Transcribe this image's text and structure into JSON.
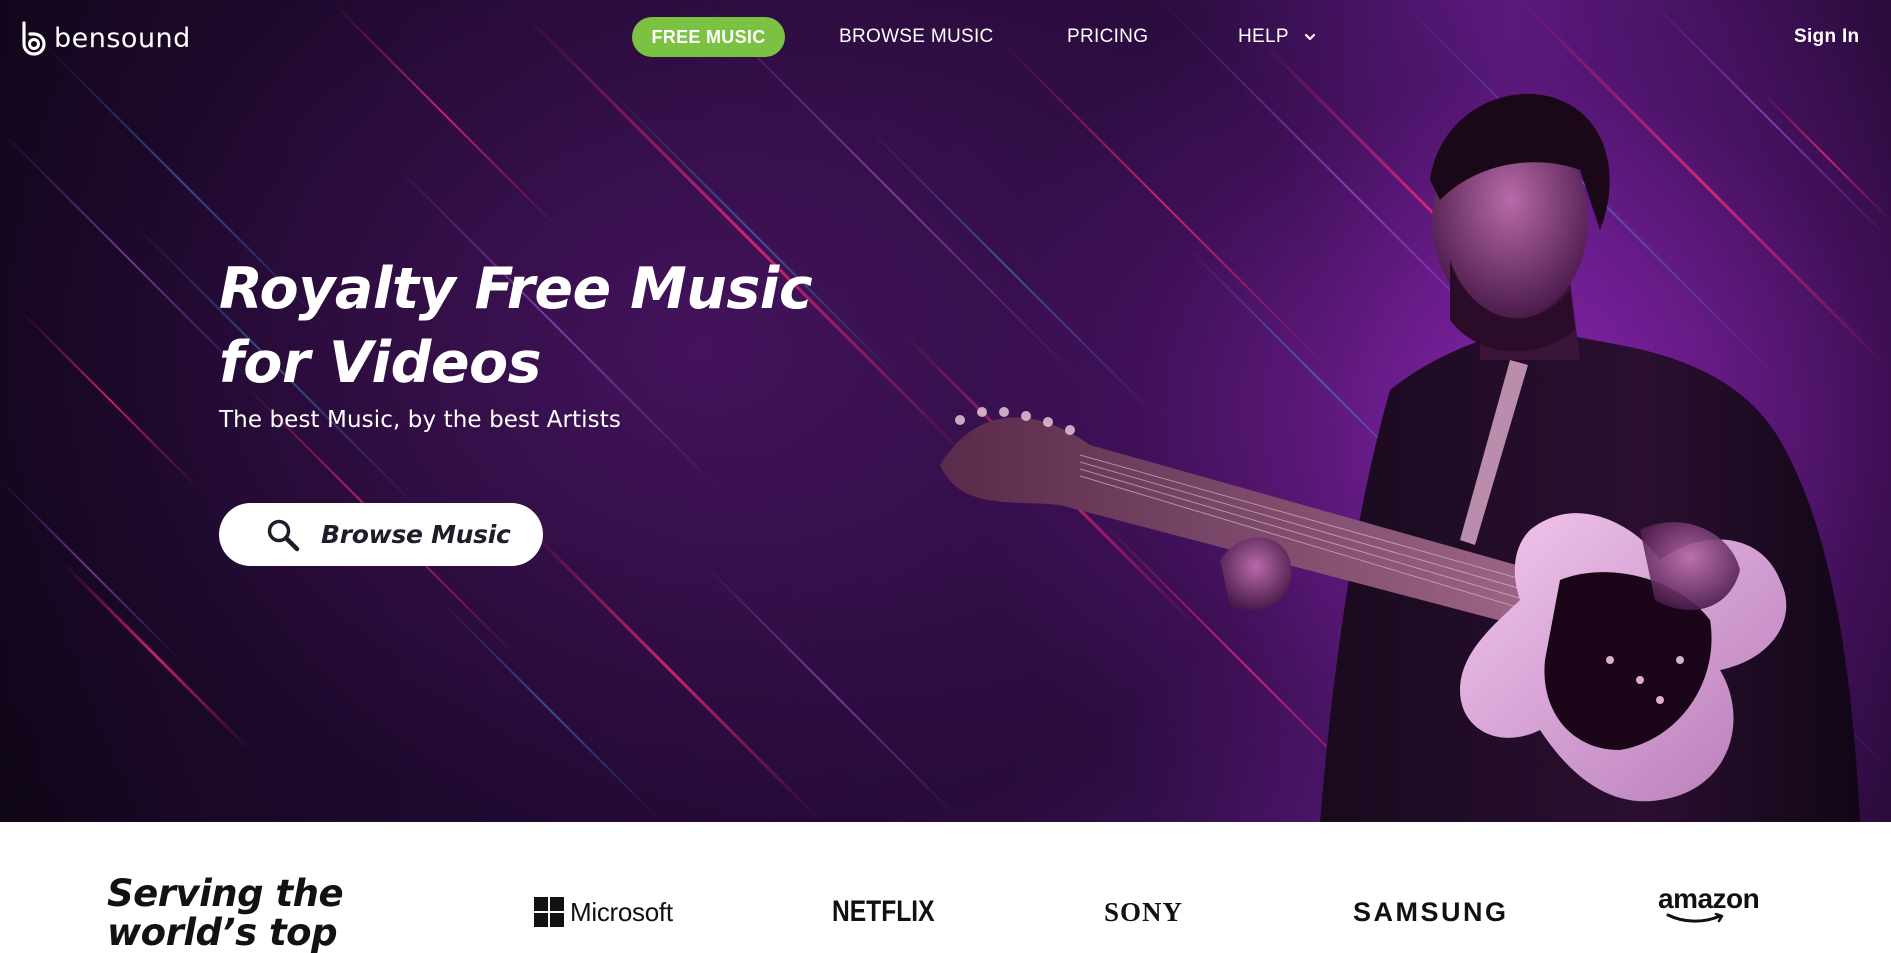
{
  "nav": {
    "logo_text": "bensound",
    "free_music": "FREE MUSIC",
    "browse_music": "BROWSE MUSIC",
    "pricing": "PRICING",
    "help": "HELP",
    "sign_in": "Sign In"
  },
  "hero": {
    "title_line1": "Royalty Free Music",
    "title_line2": "for Videos",
    "subtitle": "The best Music, by the best Artists",
    "browse_button": "Browse Music"
  },
  "brands": {
    "serving_line1": "Serving the",
    "serving_line2": "world’s top",
    "logos": [
      "Microsoft",
      "NETFLIX",
      "SONY",
      "SAMSUNG",
      "amazon"
    ]
  },
  "colors": {
    "accent_green": "#7bc142",
    "hero_purple": "#3c1258",
    "text_dark": "#121212"
  },
  "icons": {
    "logo": "bensound-b-icon",
    "help_dropdown": "chevron-down-icon",
    "browse": "search-icon"
  }
}
